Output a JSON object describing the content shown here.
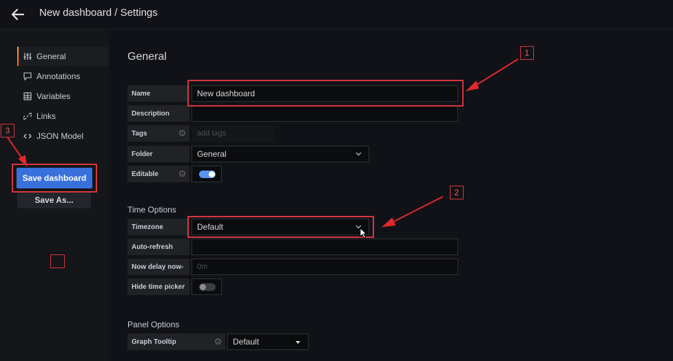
{
  "topbar": {
    "title": "New dashboard / Settings",
    "back_icon": "arrow-left-icon"
  },
  "sidebar": {
    "items": [
      {
        "label": "General",
        "icon": "sliders-icon",
        "active": true
      },
      {
        "label": "Annotations",
        "icon": "comment-icon",
        "active": false
      },
      {
        "label": "Variables",
        "icon": "calculator-icon",
        "active": false
      },
      {
        "label": "Links",
        "icon": "link-icon",
        "active": false
      },
      {
        "label": "JSON Model",
        "icon": "code-icon",
        "active": false
      }
    ],
    "save_label": "Save dashboard",
    "save_as_label": "Save As..."
  },
  "general": {
    "heading": "General",
    "name_label": "Name",
    "name_value": "New dashboard",
    "description_label": "Description",
    "description_value": "",
    "tags_label": "Tags",
    "tags_placeholder": "add tags",
    "folder_label": "Folder",
    "folder_value": "General",
    "editable_label": "Editable",
    "editable_on": true
  },
  "time_options": {
    "title": "Time Options",
    "timezone_label": "Timezone",
    "timezone_value": "Default",
    "autorefresh_label": "Auto-refresh",
    "autorefresh_value": "",
    "nowdelay_label": "Now delay now-",
    "nowdelay_placeholder": "0m",
    "hidetime_label": "Hide time picker",
    "hidetime_on": false
  },
  "panel_options": {
    "title": "Panel Options",
    "tooltip_label": "Graph Tooltip",
    "tooltip_value": "Default"
  },
  "annotations": {
    "badge_1": "1",
    "badge_2": "2",
    "badge_3": "3"
  },
  "colors": {
    "accent_blue": "#3871dc",
    "callout_red": "#d9363e",
    "toggle_on": "#5794f2"
  }
}
